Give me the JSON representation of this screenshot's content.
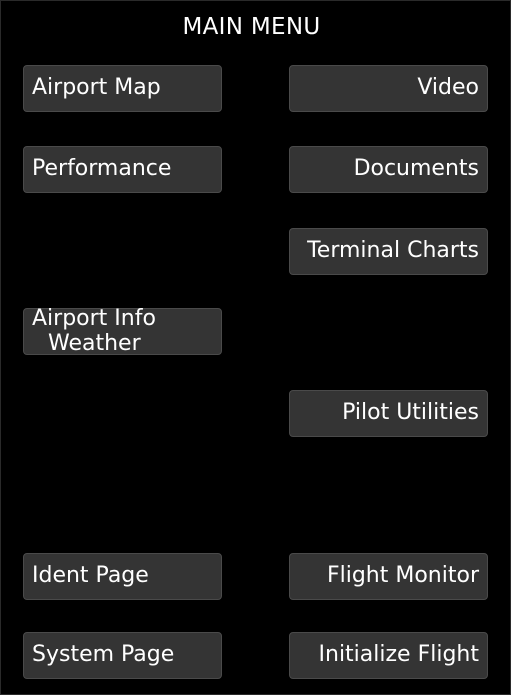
{
  "menu": {
    "title": "MAIN MENU",
    "buttons": {
      "airport_map": "Airport Map",
      "video": "Video",
      "performance": "Performance",
      "documents": "Documents",
      "terminal_charts": "Terminal Charts",
      "airport_info_line1": "Airport Info",
      "airport_info_line2": "Weather",
      "pilot_utilities": "Pilot Utilities",
      "ident_page": "Ident Page",
      "flight_monitor": "Flight Monitor",
      "system_page": "System Page",
      "initialize_flight": "Initialize Flight"
    }
  },
  "colors": {
    "background": "#000000",
    "button_fill": "#343434",
    "button_border": "#4a4a4a",
    "text": "#ffffff"
  }
}
